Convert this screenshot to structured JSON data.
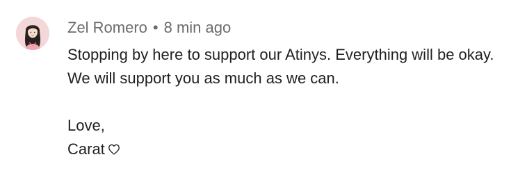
{
  "comment": {
    "author": "Zel Romero",
    "separator": "•",
    "time": "8 min ago",
    "paragraph1": "Stopping by here to support our Atinys. Everything will be okay. We will support you as much as we can.",
    "closing": "Love,",
    "signature": "Carat",
    "signature_icon": "heart-outline-icon"
  },
  "colors": {
    "meta_text": "#6b6b6b",
    "body_text": "#1f1f1f",
    "avatar_bg": "#f3d7d9"
  }
}
